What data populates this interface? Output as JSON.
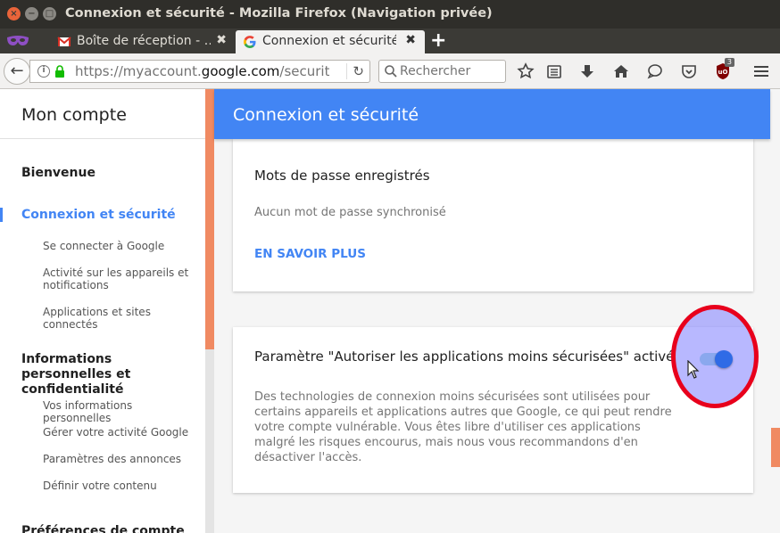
{
  "window": {
    "title": "Connexion et sécurité - Mozilla Firefox (Navigation privée)"
  },
  "tabs": [
    {
      "label": "Boîte de réception - …",
      "icon": "gmail-icon"
    },
    {
      "label": "Connexion et sécurité",
      "icon": "google-icon"
    }
  ],
  "navbar": {
    "url_prefix": "https://myaccount.",
    "url_host": "google.com",
    "url_suffix": "/security",
    "search_placeholder": "Rechercher",
    "extension_badge": "3"
  },
  "sidebar": {
    "title": "Mon compte",
    "items": [
      {
        "label": "Bienvenue"
      },
      {
        "label": "Connexion et sécurité",
        "active": true
      },
      {
        "label": "Informations personnelles et confidentialité"
      },
      {
        "label": "Préférences de compte"
      }
    ],
    "sub_security": [
      "Se connecter à Google",
      "Activité sur les appareils et notifications",
      "Applications et sites connectés"
    ],
    "sub_privacy": [
      "Vos informations personnelles",
      "Gérer votre activité Google",
      "Paramètres des annonces",
      "Définir votre contenu"
    ]
  },
  "header": {
    "title": "Connexion et sécurité"
  },
  "card_passwords": {
    "title": "Mots de passe enregistrés",
    "text": "Aucun mot de passe synchronisé",
    "link": "EN SAVOIR PLUS"
  },
  "card_less_secure": {
    "title": "Paramètre \"Autoriser les applications moins sécurisées\" activé",
    "text": "Des technologies de connexion moins sécurisées sont utilisées pour certains appareils et applications autres que Google, ce qui peut rendre votre compte vulnérable. Vous êtes libre d'utiliser ces applications malgré les risques encourus, mais nous vous recommandons d'en désactiver l'accès.",
    "toggle_on": true
  },
  "colors": {
    "accent": "#4285f4",
    "scroll_thumb": "#f08a62",
    "highlight_ring": "#e8001c"
  }
}
